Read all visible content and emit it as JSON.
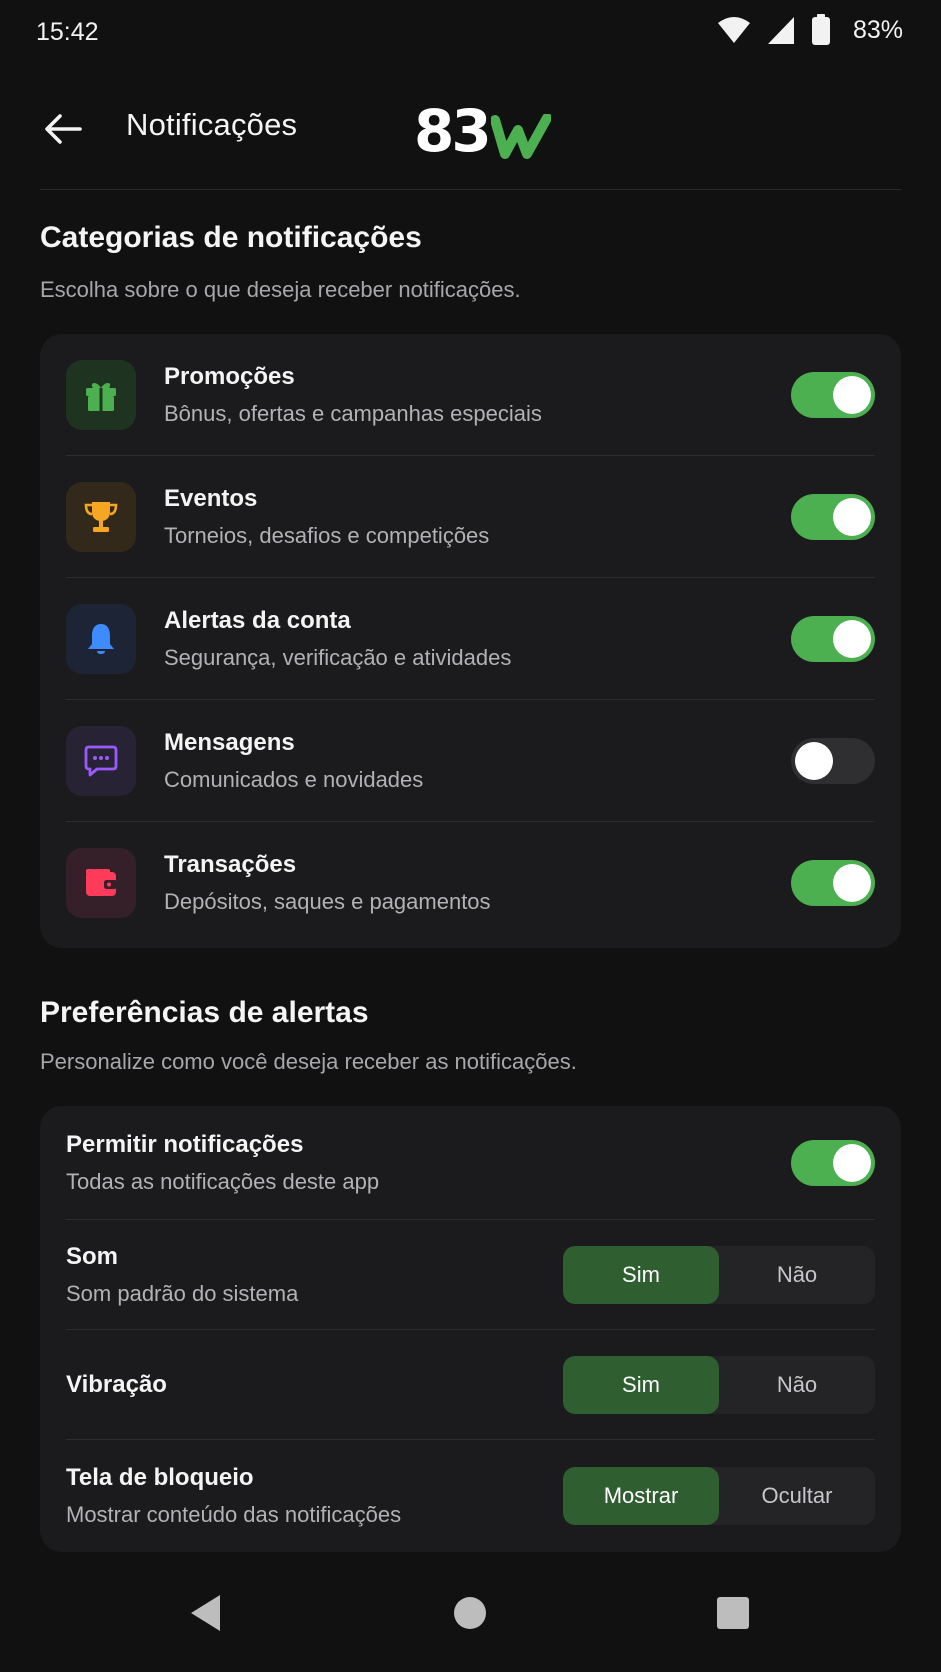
{
  "status_bar": {
    "time": "15:42",
    "battery": "83%",
    "icons": [
      "wifi-icon",
      "signal-icon",
      "battery-icon"
    ]
  },
  "header": {
    "title": "Notificações",
    "logo_text": "83",
    "logo_accent": "w",
    "back_icon": "arrow-left-icon"
  },
  "categories": {
    "title": "Categorias de notificações",
    "subtitle": "Escolha sobre o que deseja receber notificações.",
    "items": [
      {
        "title": "Promoções",
        "subtitle": "Bônus, ofertas e campanhas especiais",
        "icon": "gift-icon",
        "enabled": true,
        "icon_color": "#4caf50",
        "tile_color": "#1f3321"
      },
      {
        "title": "Eventos",
        "subtitle": "Torneios, desafios e competições",
        "icon": "trophy-icon",
        "enabled": true,
        "icon_color": "#f5a623",
        "tile_color": "#33291a"
      },
      {
        "title": "Alertas da conta",
        "subtitle": "Segurança, verificação e atividades",
        "icon": "bell-icon",
        "enabled": true,
        "icon_color": "#3d8bff",
        "tile_color": "#1c2435"
      },
      {
        "title": "Mensagens",
        "subtitle": "Comunicados e novidades",
        "icon": "chat-icon",
        "enabled": false,
        "icon_color": "#9b59ff",
        "tile_color": "#272335"
      },
      {
        "title": "Transações",
        "subtitle": "Depósitos, saques e pagamentos",
        "icon": "wallet-icon",
        "enabled": true,
        "icon_color": "#ff3b5c",
        "tile_color": "#35202a"
      }
    ]
  },
  "preferences": {
    "title": "Preferências de alertas",
    "subtitle": "Personalize como você deseja receber as notificações.",
    "allow": {
      "title": "Permitir notificações",
      "subtitle": "Todas as notificações deste app",
      "enabled": true
    },
    "sound": {
      "title": "Som",
      "subtitle": "Som padrão do sistema",
      "options": [
        "Sim",
        "Não"
      ],
      "selected": "Sim"
    },
    "vibration": {
      "title": "Vibração",
      "options": [
        "Sim",
        "Não"
      ],
      "selected": "Sim"
    },
    "lockscreen": {
      "title": "Tela de bloqueio",
      "subtitle": "Mostrar conteúdo das notificações",
      "options": [
        "Mostrar",
        "Ocultar"
      ],
      "selected": "Mostrar"
    }
  },
  "nav_bar": {
    "icons": [
      "nav-back-icon",
      "nav-home-icon",
      "nav-recents-icon"
    ]
  },
  "colors": {
    "accent": "#4caf50",
    "background": "#111112",
    "card": "#1b1b1d",
    "segment_active": "#2f5e31"
  }
}
